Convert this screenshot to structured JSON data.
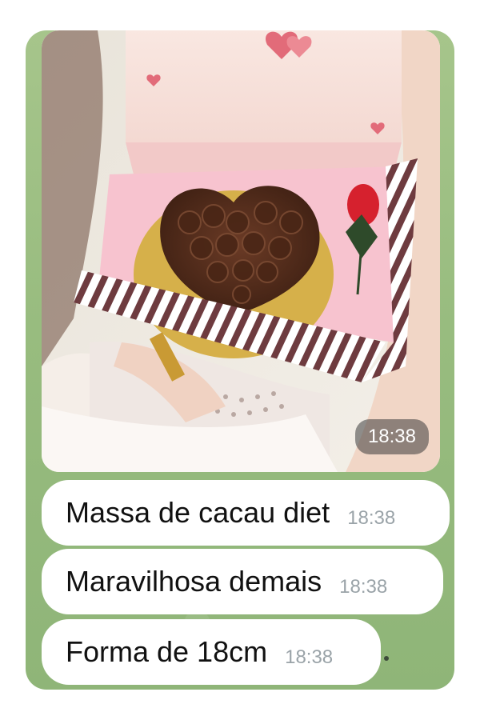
{
  "messages": {
    "photo": {
      "time": "18:38"
    },
    "texts": [
      {
        "text": "Massa de cacau diet",
        "time": "18:38"
      },
      {
        "text": "Maravilhosa demais",
        "time": "18:38"
      },
      {
        "text": "Forma de 18cm",
        "time": "18:38"
      }
    ]
  },
  "colors": {
    "chat_background": "#9cbf83",
    "bubble": "#ffffff",
    "time_text": "#9aa3a8"
  }
}
